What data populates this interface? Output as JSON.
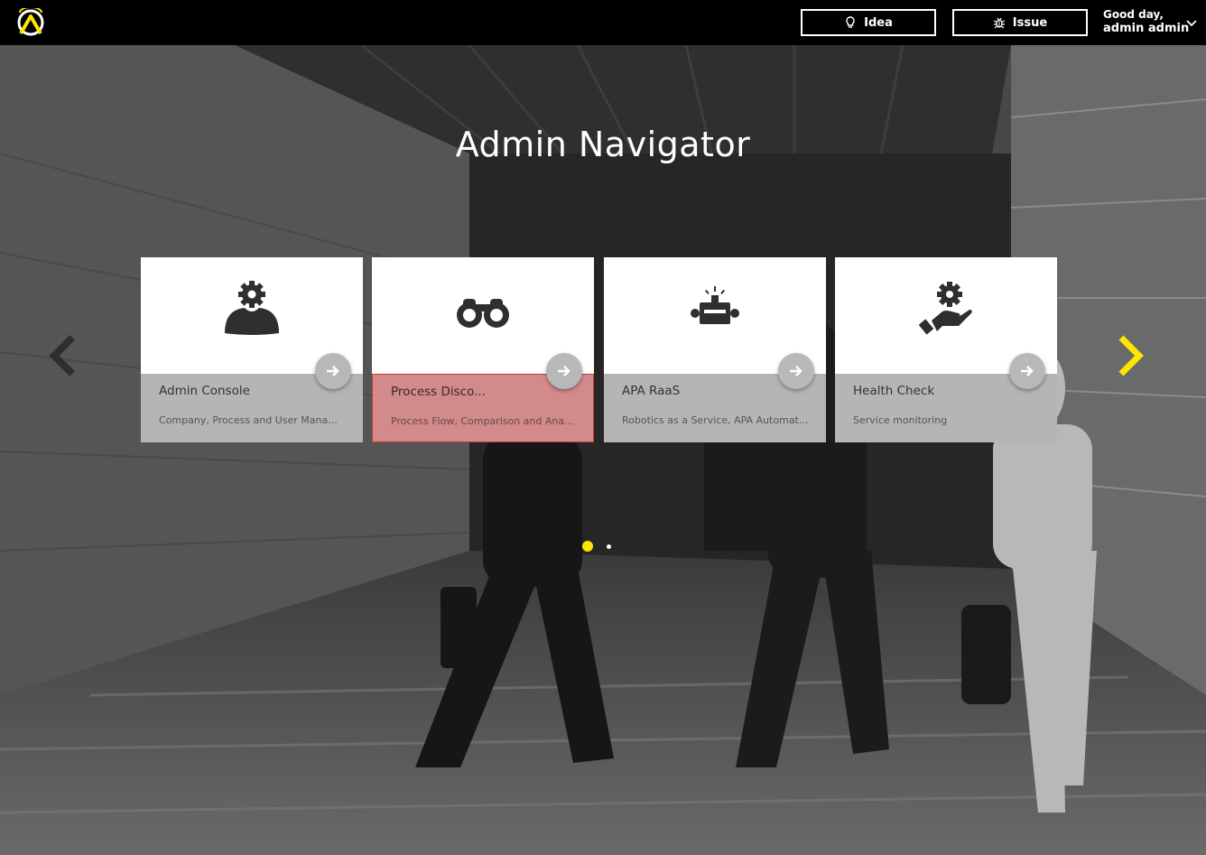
{
  "header": {
    "idea_label": "Idea",
    "issue_label": "Issue",
    "greeting": "Good day,",
    "user_name": "admin admin"
  },
  "page": {
    "title": "Admin Navigator"
  },
  "cards": [
    {
      "title": "Admin Console",
      "description": "Company, Process and User Mana...",
      "icon": "admin-gear-person-icon"
    },
    {
      "title": "Process Disco...",
      "description": "Process Flow, Comparison and Ana...",
      "icon": "binoculars-icon",
      "selected": true
    },
    {
      "title": "APA RaaS",
      "description": "Robotics as a Service, APA Automat...",
      "icon": "robot-icon"
    },
    {
      "title": "Health Check",
      "description": "Service monitoring",
      "icon": "hand-gear-icon"
    }
  ],
  "carousel": {
    "page_count": 2,
    "active_page": 1
  },
  "colors": {
    "accent": "#ffe600",
    "topbar": "#000000",
    "card_bottom": "#b5b5b5",
    "selected": "#c43a3a"
  }
}
